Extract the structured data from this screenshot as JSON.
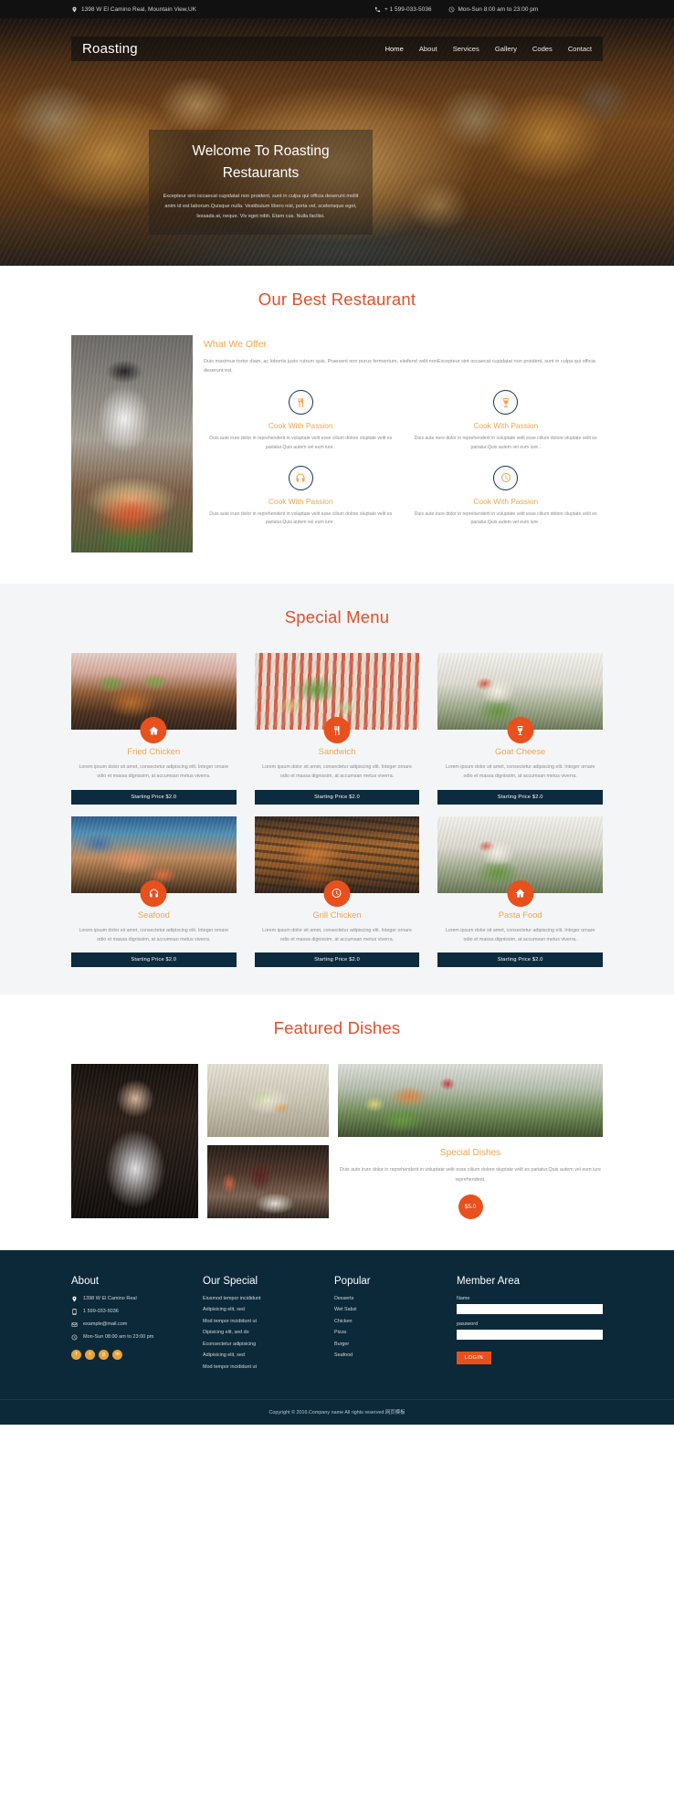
{
  "topbar": {
    "address": "1398 W El Camino Real, Mountain View,UK",
    "phone": "+ 1 599-033-5036",
    "hours": "Mon-Sun 8:00 am to 23:00 pm",
    "location_icon": "map-pin-icon",
    "phone_icon": "phone-icon",
    "clock_icon": "clock-icon"
  },
  "nav": {
    "brand": "Roasting",
    "links": [
      {
        "label": "Home"
      },
      {
        "label": "About"
      },
      {
        "label": "Services"
      },
      {
        "label": "Gallery"
      },
      {
        "label": "Codes"
      },
      {
        "label": "Contact"
      }
    ]
  },
  "hero": {
    "title": "Welcome To Roasting Restaurants",
    "text": "Excepteur sint occaecat cupidatat non proident, sunt in culpa qui officia deserunt mollit anim id est laborum.Quisque nulla. Vestibulum libero nisl, porta vel, scelerisque eget, lessada at, neque. Viv eget nibh. Etam cus. Nulla facilisi."
  },
  "best": {
    "title": "Our Best Restaurant",
    "offer_heading": "What We Offer",
    "offer_text": "Duis maximus tortor diam, ac lobortis justo rutrum quis. Praesent non purus fermentum, eleifend velit nonExcepteur sint occaecat cupidatat non proident, sunt in culpa qui officia deserunt est.",
    "features": [
      {
        "title": "Cook With Passion",
        "text": "Duis aute irure dolor in reprehenderit in voluptate velit esse cilium dolore oluptate velit es pariatur.Quis autem vel eum iure .",
        "icon": "fork-knife-icon"
      },
      {
        "title": "Cook With Passion",
        "text": "Duis aute irure dolor in reprehenderit in voluptate velit esse cilium dolore oluptate velit es pariatur.Quis autem vel eum iure .",
        "icon": "wine-glass-icon"
      },
      {
        "title": "Cook With Passion",
        "text": "Duis aute irure dolor in reprehenderit in voluptate velit esse cilium dolore oluptate velit es pariatur.Quis autem vel eum iure .",
        "icon": "headphones-icon"
      },
      {
        "title": "Cook With Passion",
        "text": "Duis aute irure dolor in reprehenderit in voluptate velit esse cilium dolore oluptate velit es pariatur.Quis autem vel eum iure .",
        "icon": "clock-icon"
      }
    ]
  },
  "special": {
    "title": "Special Menu",
    "items": [
      {
        "name": "Fried Chicken",
        "text": "Lorem ipsum dolor sit amet, consectetur adipiscing elit. Integer ornare odio et massa dignissim, at accumsan metus viverra.",
        "price": "Starting Price $2.0",
        "icon": "home-icon",
        "photo": "ph-fried"
      },
      {
        "name": "Sandwich",
        "text": "Lorem ipsum dolor sit amet, consectetur adipiscing elit. Integer ornare odio et massa dignissim, at accumsan metus viverra.",
        "price": "Starting Price $2.0",
        "icon": "fork-knife-icon",
        "photo": "ph-sandwich"
      },
      {
        "name": "Goat Cheese",
        "text": "Lorem ipsum dolor sit amet, consectetur adipiscing elit. Integer ornare odio et massa dignissim, at accumsan metus viverra.",
        "price": "Starting Price $2.0",
        "icon": "wine-glass-icon",
        "photo": "ph-goat"
      },
      {
        "name": "Seafood",
        "text": "Lorem ipsum dolor sit amet, consectetur adipiscing elit. Integer ornare odio et massa dignissim, at accumsan metus viverra.",
        "price": "Starting Price $2.0",
        "icon": "headphones-icon",
        "photo": "ph-seafood"
      },
      {
        "name": "Grill Chicken",
        "text": "Lorem ipsum dolor sit amet, consectetur adipiscing elit. Integer ornare odio et massa dignissim, at accumsan metus viverra.",
        "price": "Starting Price $2.0",
        "icon": "clock-icon",
        "photo": "ph-grill"
      },
      {
        "name": "Pasta Food",
        "text": "Lorem ipsum dolor sit amet, consectetur adipiscing elit. Integer ornare odio et massa dignissim, at accumsan metus viverra.",
        "price": "Starting Price $2.0",
        "icon": "home-icon",
        "photo": "ph-pasta"
      }
    ]
  },
  "featured": {
    "title": "Featured Dishes",
    "dish_title": "Special Dishes",
    "dish_text": "Duis aute irure dolor in reprehenderit in voluptate velit esse cilium dolore oluptate velit es pariatur.Quis autem vel eum iure reprehenderit.",
    "price": "$5.0"
  },
  "footer": {
    "about": {
      "heading": "About",
      "address": "1398 W El Camino Real",
      "phone": "1 599-033-5036",
      "email": "example@mail.com",
      "hours": "Mon-Sun 08:00 am to 23:00 pm",
      "socials": [
        {
          "name": "facebook-icon",
          "glyph": "f"
        },
        {
          "name": "twitter-icon",
          "glyph": "t"
        },
        {
          "name": "google-plus-icon",
          "glyph": "g"
        },
        {
          "name": "linkedin-icon",
          "glyph": "in"
        }
      ]
    },
    "our_special": {
      "heading": "Our Special",
      "items": [
        "Eiusmod tempor incididunt",
        "Adipisicing elit, sed",
        "Mod tempor incididunt ut",
        "Dipisicing elit, sed do",
        "Econsectetur adipisicing",
        "Adipisicing elit, sed",
        "Mod tempor incididunt ut"
      ]
    },
    "popular": {
      "heading": "Popular",
      "items": [
        "Desserts",
        "Wet Sabzi",
        "Chicken",
        "Pizza",
        "Burger",
        "Seafood"
      ]
    },
    "member": {
      "heading": "Member Area",
      "name_label": "Name",
      "name_value": "",
      "password_label": "password",
      "password_value": "",
      "login_label": "LOGIN"
    },
    "copyright": "Copyright © 2016.Company name All rights reserved.网页模板"
  },
  "colors": {
    "accent_orange": "#e8501d",
    "accent_gold": "#efa648",
    "navy": "#0c2939",
    "title_red": "#e04f2a"
  }
}
